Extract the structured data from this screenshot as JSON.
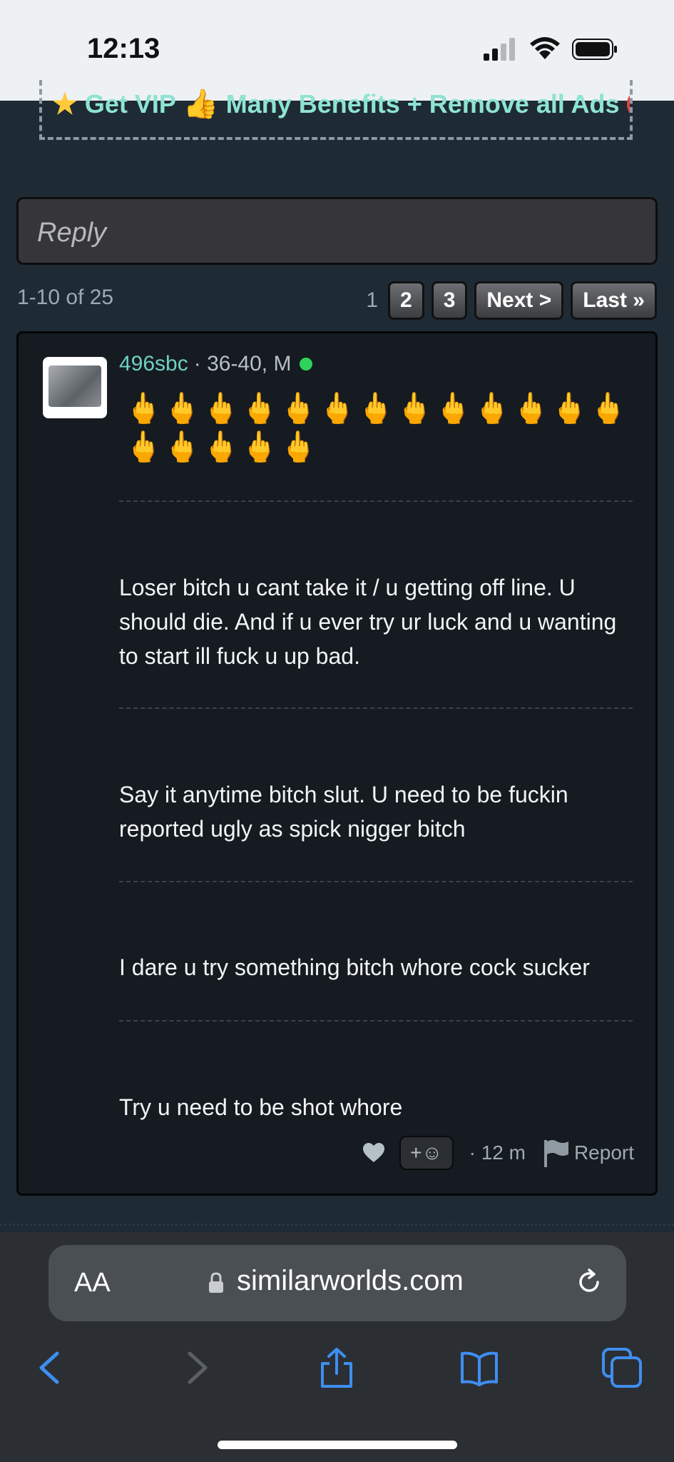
{
  "status_bar": {
    "time": "12:13"
  },
  "vip_banner": {
    "text_1": "Get VIP",
    "text_2": "Many Benefits + Remove all Ads"
  },
  "reply": {
    "placeholder": "Reply"
  },
  "pager": {
    "count": "1-10 of 25",
    "current": "1",
    "pages": [
      "2",
      "3"
    ],
    "next": "Next >",
    "last": "Last »"
  },
  "post": {
    "username": "496sbc",
    "meta": "· 36-40, M",
    "emoji": "🖕🖕🖕🖕🖕🖕🖕🖕🖕🖕🖕🖕🖕🖕🖕🖕🖕🖕",
    "messages": [
      "Loser bitch u cant take it / u getting off line. U should die. And if u ever try ur luck and u wanting to start ill fuck u up bad.",
      "Say it anytime bitch slut. U need to be fuckin reported ugly as spick nigger bitch",
      "I dare u try something bitch whore cock sucker",
      "Try u need to be shot whore"
    ],
    "emoji_add": "+☺",
    "time_ago": "· 12 m",
    "report": "Report"
  },
  "browser": {
    "aa": "AA",
    "url": "similarworlds.com"
  }
}
